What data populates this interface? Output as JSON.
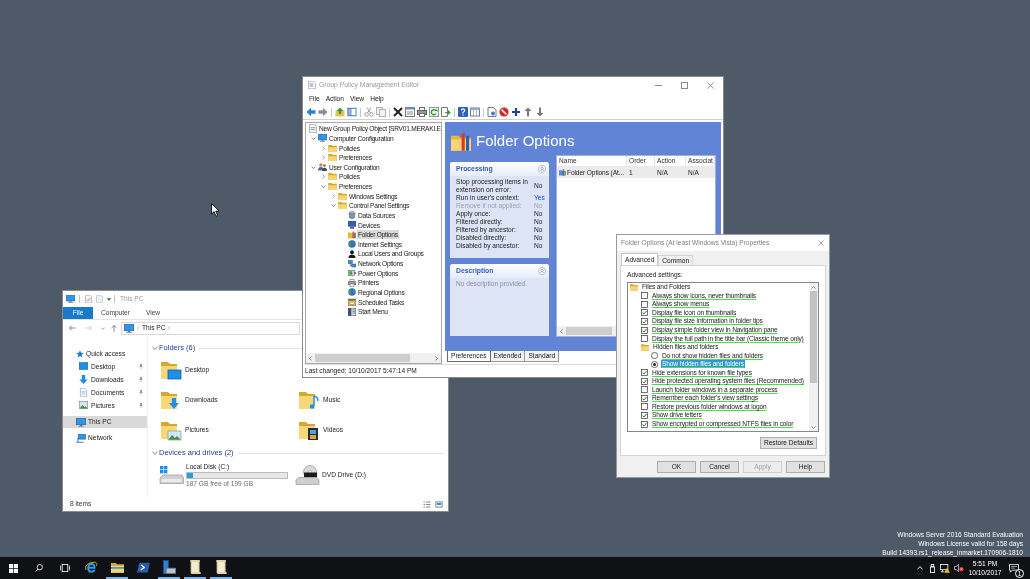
{
  "desktop": {
    "notice": [
      "Windows Server 2016 Standard Evaluation",
      "Windows License valid for 158 days",
      "Build 14393.rs1_release_inmarket.170906-1810"
    ]
  },
  "explorer": {
    "title": "This PC",
    "ribbon_tabs": [
      {
        "label": "File",
        "kind": "menu"
      },
      {
        "label": "Computer",
        "kind": "tab"
      },
      {
        "label": "View",
        "kind": "tab"
      }
    ],
    "address": [
      "This PC"
    ],
    "nav_pane": [
      {
        "label": "Quick access",
        "selected": false,
        "children": [
          {
            "label": "Desktop",
            "pinned": true,
            "selected": false
          },
          {
            "label": "Downloads",
            "pinned": true,
            "selected": false
          },
          {
            "label": "Documents",
            "pinned": true,
            "selected": false
          },
          {
            "label": "Pictures",
            "pinned": true,
            "selected": false
          }
        ]
      },
      {
        "label": "This PC",
        "selected": true
      },
      {
        "label": "Network",
        "selected": false
      }
    ],
    "folders": {
      "heading": "Folders (6)",
      "expanded": true,
      "rows": [
        [
          "Desktop"
        ],
        [
          "Downloads",
          "Music"
        ],
        [
          "Pictures",
          "Videos"
        ]
      ]
    },
    "drives": {
      "heading": "Devices and drives (2)",
      "expanded": true,
      "items": [
        {
          "kind": "disk",
          "name": "Local Disk (C:)",
          "level": 0.06,
          "free": "187 GB free of 199 GB"
        },
        {
          "kind": "dvd",
          "name": "DVD Drive (D:)"
        }
      ]
    },
    "status": "8 items",
    "views": [
      {
        "kind": "details",
        "selected": false
      },
      {
        "kind": "tiles",
        "selected": true
      }
    ]
  },
  "gpme": {
    "title": "Group Policy Management Editor",
    "menu": [
      "File",
      "Action",
      "View",
      "Help"
    ],
    "tree": [
      {
        "label": "New Group Policy Object [SRV01.MERAKI.E",
        "selected": false,
        "children": [
          {
            "label": "Computer Configuration",
            "expanded": true,
            "selected": false,
            "children": [
              {
                "label": "Policies",
                "expanded": false,
                "selected": false
              },
              {
                "label": "Preferences",
                "expanded": false,
                "selected": false
              }
            ]
          },
          {
            "label": "User Configuration",
            "expanded": true,
            "selected": false,
            "children": [
              {
                "label": "Policies",
                "expanded": false,
                "selected": false
              },
              {
                "label": "Preferences",
                "expanded": true,
                "selected": false,
                "children": [
                  {
                    "label": "Windows Settings",
                    "expanded": false,
                    "selected": false
                  },
                  {
                    "label": "Control Panel Settings",
                    "expanded": true,
                    "selected": false,
                    "children": [
                      {
                        "label": "Data Sources",
                        "selected": false
                      },
                      {
                        "label": "Devices",
                        "selected": false
                      },
                      {
                        "label": "Folder Options",
                        "selected": true
                      },
                      {
                        "label": "Internet Settings",
                        "selected": false
                      },
                      {
                        "label": "Local Users and Groups",
                        "selected": false
                      },
                      {
                        "label": "Network Options",
                        "selected": false
                      },
                      {
                        "label": "Power Options",
                        "selected": false
                      },
                      {
                        "label": "Printers",
                        "selected": false
                      },
                      {
                        "label": "Regional Options",
                        "selected": false
                      },
                      {
                        "label": "Scheduled Tasks",
                        "selected": false
                      },
                      {
                        "label": "Start Menu",
                        "selected": false
                      }
                    ]
                  }
                ]
              }
            ]
          }
        ]
      }
    ],
    "status": "Last changed: 10/10/2017 5:47:14 PM",
    "header": "Folder Options",
    "processing": {
      "title": "Processing",
      "expanded": true,
      "rows": [
        {
          "label": "Stop processing items in extension on error:",
          "value": "No",
          "on": false,
          "disabled": false
        },
        {
          "label": "Run in user's context:",
          "value": "Yes",
          "on": true,
          "disabled": false
        },
        {
          "label": "Remove if not applied:",
          "value": "No",
          "on": false,
          "disabled": true
        },
        {
          "label": "Apply once:",
          "value": "No",
          "on": false,
          "disabled": false
        },
        {
          "label": "Filtered directly:",
          "value": "No",
          "on": false,
          "disabled": false
        },
        {
          "label": "Filtered by ancestor:",
          "value": "No",
          "on": false,
          "disabled": false
        },
        {
          "label": "Disabled directly:",
          "value": "No",
          "on": false,
          "disabled": false
        },
        {
          "label": "Disabled by ancestor:",
          "value": "No",
          "on": false,
          "disabled": false
        }
      ]
    },
    "description": {
      "title": "Description",
      "expanded": true,
      "text": "No description provided."
    },
    "list": {
      "columns": [
        "Name",
        "Order",
        "Action",
        "Associat"
      ],
      "rows": [
        {
          "cells": [
            "Folder Options (At...",
            "1",
            "N/A",
            "N/A"
          ],
          "selected": true
        }
      ]
    },
    "tabs": [
      {
        "label": "Preferences",
        "selected": true
      },
      {
        "label": "Extended",
        "selected": false
      },
      {
        "label": "Standard",
        "selected": false
      }
    ]
  },
  "dialog": {
    "title": "Folder Options (At least Windows Vista) Properties",
    "tabs": [
      {
        "label": "Advanced",
        "selected": true
      },
      {
        "label": "Common",
        "selected": false
      }
    ],
    "settings_label": "Advanced settings:",
    "settings": [
      {
        "kind": "folder",
        "label": "Files and Folders",
        "selected": false,
        "children": [
          {
            "kind": "checkbox",
            "label": "Always show icons, never thumbnails",
            "checked": false,
            "applied": true,
            "selected": false
          },
          {
            "kind": "checkbox",
            "label": "Always show menus",
            "checked": false,
            "applied": true,
            "selected": false
          },
          {
            "kind": "checkbox",
            "label": "Display file icon on thumbnails",
            "checked": true,
            "applied": true,
            "selected": false
          },
          {
            "kind": "checkbox",
            "label": "Display file size information in folder tips",
            "checked": true,
            "applied": true,
            "selected": false
          },
          {
            "kind": "checkbox",
            "label": "Display simple folder view in Navigation pane",
            "checked": true,
            "applied": true,
            "selected": false
          },
          {
            "kind": "checkbox",
            "label": "Display the full path in the title bar (Classic theme only)",
            "checked": false,
            "applied": true,
            "selected": false
          },
          {
            "kind": "folder",
            "label": "Hidden files and folders",
            "selected": false,
            "children": [
              {
                "kind": "radio",
                "label": "Do not show hidden files and folders",
                "checked": false,
                "applied": true,
                "selected": false
              },
              {
                "kind": "radio",
                "label": "Show hidden files and folders",
                "checked": true,
                "applied": true,
                "selected": true
              }
            ]
          },
          {
            "kind": "checkbox",
            "label": "Hide extensions for known file types",
            "checked": true,
            "applied": true,
            "selected": false
          },
          {
            "kind": "checkbox",
            "label": "Hide protected operating system files (Recommended)",
            "checked": true,
            "applied": true,
            "selected": false
          },
          {
            "kind": "checkbox",
            "label": "Launch folder windows in a separate process",
            "checked": false,
            "applied": true,
            "selected": false
          },
          {
            "kind": "checkbox",
            "label": "Remember each folder's view settings",
            "checked": true,
            "applied": true,
            "selected": false
          },
          {
            "kind": "checkbox",
            "label": "Restore previous folder windows at logon",
            "checked": false,
            "applied": true,
            "selected": false
          },
          {
            "kind": "checkbox",
            "label": "Show drive letters",
            "checked": true,
            "applied": true,
            "selected": false
          },
          {
            "kind": "checkbox",
            "label": "Show encrypted or compressed NTFS files in color",
            "checked": true,
            "applied": true,
            "selected": false
          }
        ]
      }
    ],
    "restore": "Restore Defaults",
    "buttons": [
      {
        "label": "OK",
        "disabled": false
      },
      {
        "label": "Cancel",
        "disabled": false
      },
      {
        "label": "Apply",
        "disabled": true
      },
      {
        "label": "Help",
        "disabled": false
      }
    ]
  },
  "taskbar": {
    "apps": [
      {
        "kind": "browser",
        "running": false
      },
      {
        "kind": "files",
        "running": true
      },
      {
        "kind": "shell",
        "running": false
      },
      {
        "kind": "server",
        "running": true
      },
      {
        "kind": "document",
        "running": true
      },
      {
        "kind": "document",
        "running": true
      }
    ],
    "time": "5:51 PM",
    "date": "10/10/2017",
    "notifications": "1"
  }
}
